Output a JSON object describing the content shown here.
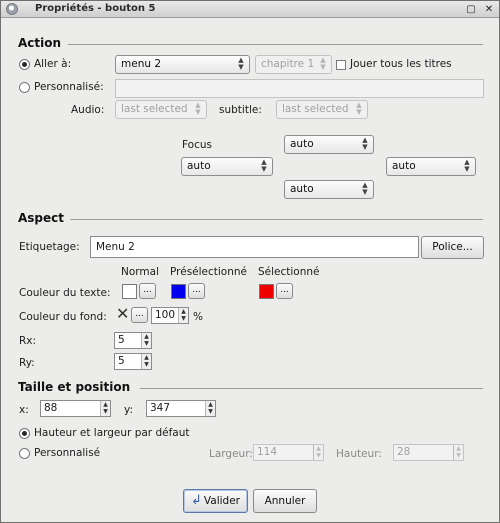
{
  "window": {
    "title": "Propriétés - bouton 5",
    "maximize_glyph": "▢",
    "close_glyph": "✕"
  },
  "action": {
    "section_title": "Action",
    "goto_label": "Aller à:",
    "goto_menu": "menu 2",
    "goto_chapter": "chapitre 1",
    "play_all_label": "Jouer tous les titres",
    "custom_label": "Personnalisé:",
    "custom_value": "",
    "audio_label": "Audio:",
    "audio_value": "last selected",
    "subtitle_label": "subtitle:",
    "subtitle_value": "last selected",
    "focus_label": "Focus",
    "focus_top": "auto",
    "focus_left": "auto",
    "focus_right": "auto",
    "focus_bottom": "auto"
  },
  "aspect": {
    "section_title": "Aspect",
    "label_label": "Etiquetage:",
    "label_value": "Menu 2",
    "font_button": "Police...",
    "col_normal": "Normal",
    "col_preselected": "Présélectionné",
    "col_selected": "Sélectionné",
    "text_color_label": "Couleur du texte:",
    "text_color_normal": "#ffffff",
    "text_color_preselected": "#0000ee",
    "text_color_selected": "#ee0000",
    "ellipsis": "...",
    "bg_color_label": "Couleur du fond:",
    "bg_opacity": "100",
    "percent": "%",
    "rx_label": "Rx:",
    "rx_value": "5",
    "ry_label": "Ry:",
    "ry_value": "5"
  },
  "size_position": {
    "section_title": "Taille et position",
    "x_label": "x:",
    "x_value": "88",
    "y_label": "y:",
    "y_value": "347",
    "default_size_label": "Hauteur et largeur par défaut",
    "custom_label": "Personnalisé",
    "width_label": "Largeur:",
    "width_value": "114",
    "height_label": "Hauteur:",
    "height_value": "28"
  },
  "buttons": {
    "ok": "Valider",
    "cancel": "Annuler"
  }
}
